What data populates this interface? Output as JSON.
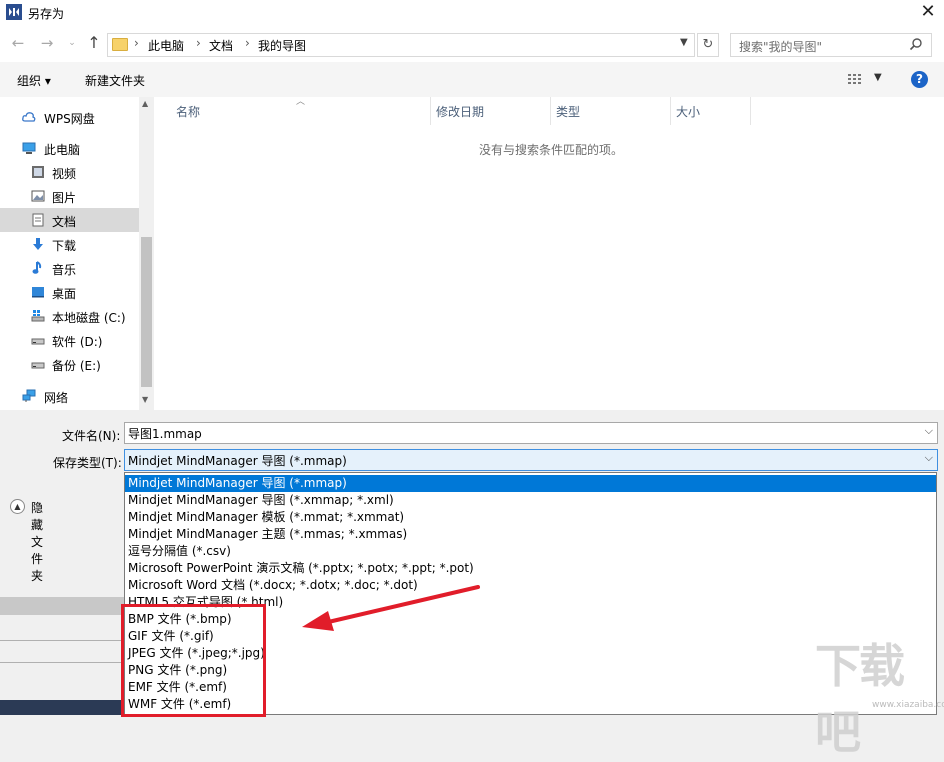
{
  "window": {
    "title": "另存为",
    "close_label": "✕"
  },
  "address": {
    "crumbs": [
      "此电脑",
      "文档",
      "我的导图"
    ],
    "search_placeholder": "搜索\"我的导图\""
  },
  "toolbar": {
    "organize": "组织 ▾",
    "new_folder": "新建文件夹",
    "help": "?"
  },
  "nav": {
    "items": [
      {
        "label": "WPS网盘",
        "icon": "cloud-icon"
      },
      {
        "label": "此电脑",
        "icon": "computer-icon"
      },
      {
        "label": "视频",
        "icon": "video-icon"
      },
      {
        "label": "图片",
        "icon": "picture-icon"
      },
      {
        "label": "文档",
        "icon": "document-icon",
        "selected": true
      },
      {
        "label": "下载",
        "icon": "download-icon"
      },
      {
        "label": "音乐",
        "icon": "music-icon"
      },
      {
        "label": "桌面",
        "icon": "desktop-icon"
      },
      {
        "label": "本地磁盘 (C:)",
        "icon": "windows-drive-icon"
      },
      {
        "label": "软件 (D:)",
        "icon": "drive-icon"
      },
      {
        "label": "备份 (E:)",
        "icon": "drive-icon"
      },
      {
        "label": "网络",
        "icon": "network-icon"
      }
    ]
  },
  "filelist": {
    "columns": [
      "名称",
      "修改日期",
      "类型",
      "大小"
    ],
    "empty_message": "没有与搜索条件匹配的项。"
  },
  "form": {
    "filename_label": "文件名(N):",
    "filename_value": "导图1.mmap",
    "type_label": "保存类型(T):",
    "type_value": "Mindjet MindManager 导图 (*.mmap)",
    "hide_folders": "隐藏文件夹"
  },
  "type_options": [
    "Mindjet MindManager 导图 (*.mmap)",
    "Mindjet MindManager 导图 (*.xmmap; *.xml)",
    "Mindjet MindManager 模板 (*.mmat; *.xmmat)",
    "Mindjet MindManager 主题 (*.mmas; *.xmmas)",
    "逗号分隔值 (*.csv)",
    "Microsoft PowerPoint 演示文稿 (*.pptx; *.potx; *.ppt; *.pot)",
    "Microsoft Word 文档 (*.docx; *.dotx; *.doc; *.dot)",
    "HTML5 交互式导图 (*.html)",
    "BMP 文件 (*.bmp)",
    "GIF 文件 (*.gif)",
    "JPEG 文件 (*.jpeg;*.jpg)",
    "PNG 文件 (*.png)",
    "EMF 文件 (*.emf)",
    "WMF 文件 (*.emf)"
  ],
  "selected_option_index": 0,
  "watermark": {
    "text": "下载吧",
    "sub": "www.xiazaiba.com"
  },
  "colors": {
    "accent": "#0078d7",
    "annotation": "#e11d2a"
  }
}
